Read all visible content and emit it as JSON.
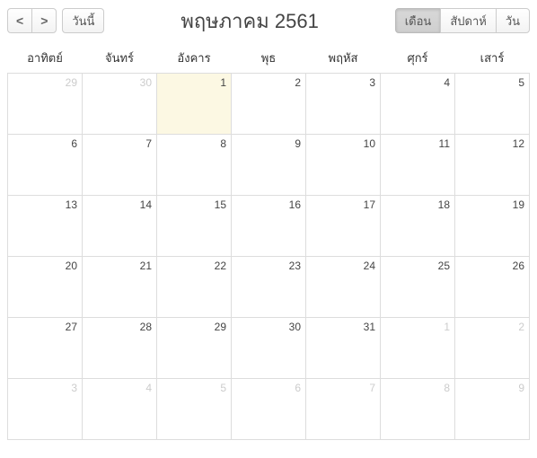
{
  "toolbar": {
    "prev": "<",
    "next": ">",
    "today": "วันนี้",
    "view_month": "เดือน",
    "view_week": "สัปดาห์",
    "view_day": "วัน"
  },
  "title": "พฤษภาคม 2561",
  "day_headers": [
    "อาทิตย์",
    "จันทร์",
    "อังคาร",
    "พุธ",
    "พฤหัส",
    "ศุกร์",
    "เสาร์"
  ],
  "weeks": [
    [
      {
        "n": "29",
        "other": true
      },
      {
        "n": "30",
        "other": true
      },
      {
        "n": "1",
        "today": true
      },
      {
        "n": "2"
      },
      {
        "n": "3"
      },
      {
        "n": "4"
      },
      {
        "n": "5"
      }
    ],
    [
      {
        "n": "6"
      },
      {
        "n": "7"
      },
      {
        "n": "8"
      },
      {
        "n": "9"
      },
      {
        "n": "10"
      },
      {
        "n": "11"
      },
      {
        "n": "12"
      }
    ],
    [
      {
        "n": "13"
      },
      {
        "n": "14"
      },
      {
        "n": "15"
      },
      {
        "n": "16"
      },
      {
        "n": "17"
      },
      {
        "n": "18"
      },
      {
        "n": "19"
      }
    ],
    [
      {
        "n": "20"
      },
      {
        "n": "21"
      },
      {
        "n": "22"
      },
      {
        "n": "23"
      },
      {
        "n": "24"
      },
      {
        "n": "25"
      },
      {
        "n": "26"
      }
    ],
    [
      {
        "n": "27"
      },
      {
        "n": "28"
      },
      {
        "n": "29"
      },
      {
        "n": "30"
      },
      {
        "n": "31"
      },
      {
        "n": "1",
        "other": true
      },
      {
        "n": "2",
        "other": true
      }
    ],
    [
      {
        "n": "3",
        "other": true
      },
      {
        "n": "4",
        "other": true
      },
      {
        "n": "5",
        "other": true
      },
      {
        "n": "6",
        "other": true
      },
      {
        "n": "7",
        "other": true
      },
      {
        "n": "8",
        "other": true
      },
      {
        "n": "9",
        "other": true
      }
    ]
  ]
}
